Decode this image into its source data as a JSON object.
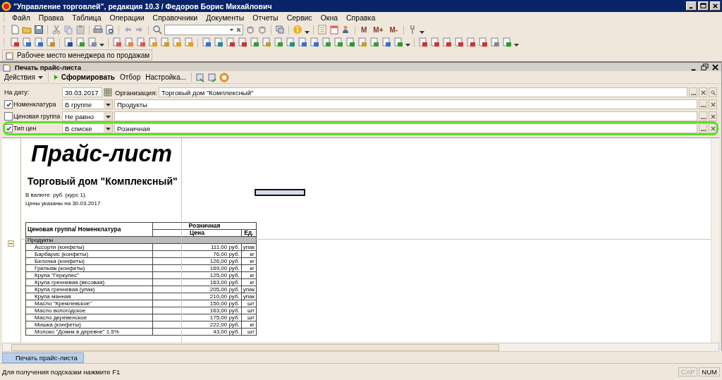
{
  "window": {
    "title": "\"Управление торговлей\", редакция 10.3 / Федоров Борис Михайлович"
  },
  "menu": [
    "Файл",
    "Правка",
    "Таблица",
    "Операции",
    "Справочники",
    "Документы",
    "Отчеты",
    "Сервис",
    "Окна",
    "Справка"
  ],
  "toolbar_text_buttons": [
    "M",
    "M+",
    "M-"
  ],
  "panel_button": "Рабочее место менеджера по продажам",
  "document": {
    "title": "Печать прайс-листа",
    "actions": [
      {
        "label": "Действия",
        "kind": "menu"
      },
      {
        "label": "Сформировать",
        "kind": "primary"
      },
      {
        "label": "Отбор",
        "kind": "plain"
      },
      {
        "label": "Настройка...",
        "kind": "plain"
      }
    ]
  },
  "date_row": {
    "label": "На дату:",
    "value": "30.03.2017",
    "org_label": "Организация:",
    "org_value": "Торговый дом \"Комплексный\""
  },
  "filters": [
    {
      "label": "Номенклатура",
      "checked": true,
      "condition": "В группе",
      "value": "Продукты",
      "highlighted": false
    },
    {
      "label": "Ценовая группа",
      "checked": false,
      "condition": "Не равно",
      "highlighted": false
    },
    {
      "label": "Тип цен",
      "checked": true,
      "condition": "В списке",
      "value": "Розничная",
      "highlighted": true
    }
  ],
  "report": {
    "title": "Прайс-лист",
    "company": "Торговый дом \"Комплексный\"",
    "currency": "В валюте: руб. (курс 1).",
    "date_note": "Цены указаны на 30.03.2017",
    "column_header": "Ценовая группа/ Номенклатура",
    "price_type": "Розничная",
    "price_col": "Цена",
    "unit_col": "Ед.",
    "groups": [
      {
        "name": "Продукты",
        "expanded": true,
        "children": [
          {
            "name": "Ассорти (конфеты)",
            "price": "111,00 руб.",
            "unit": "упак"
          },
          {
            "name": "Барбарис (конфеты)",
            "price": "76,00 руб.",
            "unit": "кг"
          },
          {
            "name": "Белочка (конфеты)",
            "price": "126,00 руб.",
            "unit": "кг"
          },
          {
            "name": "Грильяж (конфеты)",
            "price": "169,00 руб.",
            "unit": "кг"
          },
          {
            "name": "Крупа \"Геркулес\"",
            "price": "125,00 руб.",
            "unit": "кг"
          },
          {
            "name": "Крупа гречневая (весовая)",
            "price": "163,00 руб.",
            "unit": "кг"
          },
          {
            "name": "Крупа гречневая (упак)",
            "price": "205,00 руб.",
            "unit": "упак"
          },
          {
            "name": "Крупа манная",
            "price": "210,00 руб.",
            "unit": "упак"
          },
          {
            "name": "Масло \"Кремлевское\"",
            "price": "150,00 руб.",
            "unit": "шт"
          },
          {
            "name": "Масло вологодское",
            "price": "163,00 руб.",
            "unit": "шт"
          },
          {
            "name": "Масло деревенское",
            "price": "175,00 руб.",
            "unit": "шт"
          },
          {
            "name": "Мишка (конфеты)",
            "price": "222,00 руб.",
            "unit": "кг"
          },
          {
            "name": "Молоко \"Домик в деревне\" 1.5%",
            "price": "43,00 руб.",
            "unit": "шт"
          }
        ]
      }
    ]
  },
  "taskbar": [
    {
      "label": "Печать прайс-листа",
      "selected": true
    }
  ],
  "status_bar": {
    "hint": "Для получения подсказки нажмите F1",
    "indicators": [
      {
        "label": "CAP",
        "on": false
      },
      {
        "label": "NUM",
        "on": true
      }
    ]
  }
}
